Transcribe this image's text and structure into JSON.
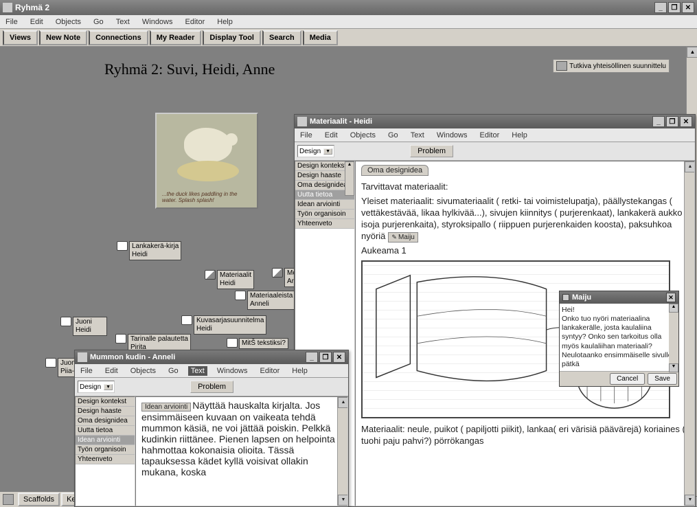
{
  "main": {
    "title": "Ryhmä 2",
    "menus": [
      "File",
      "Edit",
      "Objects",
      "Go",
      "Text",
      "Windows",
      "Editor",
      "Help"
    ],
    "toolbar": [
      "Views",
      "New Note",
      "Connections",
      "My Reader",
      "Display Tool",
      "Search",
      "Media"
    ],
    "page_heading": "Ryhmä 2: Suvi, Heidi, Anne",
    "link_label": "Tutkiva yhteisöllinen suunnittelu",
    "thumb_caption": "...the duck likes paddling in the water. Splash splash!"
  },
  "nodes": {
    "lankakera": "Lankakerä-kirja\nHeidi",
    "materiaalit": "Materiaalit\nHeidi",
    "moni": "Moni\nAnne",
    "materiaaleista": "Materiaaleista\nAnneli",
    "juoni": "Juoni\nHeidi",
    "kuvasarja": "Kuvasarjasuunnitelma\nHeidi",
    "tarinalle": "Tarinalle palautetta\nPirita",
    "mits": "MitŠ tekstiksi?",
    "juonel": "Juonel\nPiia-R"
  },
  "win_mat": {
    "title": "Materiaalit - Heidi",
    "menus": [
      "File",
      "Edit",
      "Objects",
      "Go",
      "Text",
      "Windows",
      "Editor",
      "Help"
    ],
    "combo": "Design",
    "tab": "Problem",
    "list": [
      "Design kontekst",
      "Design haaste",
      "Oma designidea",
      "Uutta tietoa",
      "Idean arviointi",
      "Työn organisoin",
      "Yhteenveto"
    ],
    "sel_idx": 3,
    "ctab": "Oma designidea",
    "p1": "Tarvittavat materiaalit:",
    "p2": "Yleiset materiaalit: sivumateriaalit ( retki- tai voimistelupatja), päällystekangas ( vettäkestävää, likaa hylkivää...), sivujen kiinnitys ( purjerenkaat), lankakerä aukko ( isoja purjerenkaita), styroksipallo ( riippuen purjerenkaiden koosta), paksuhkoa nyöriä",
    "badge": "Maiju",
    "p3": "Aukeama 1",
    "p4": "Materiaalit: neule, puikot ( papiljotti piikit), lankaa( eri värisiä päävärejä) koriaines ( tuohi paju pahvi?) pörrökangas"
  },
  "win_mum": {
    "title": "Mummon kudin - Anneli",
    "menus": [
      "File",
      "Edit",
      "Objects",
      "Go",
      "Text",
      "Windows",
      "Editor",
      "Help"
    ],
    "combo": "Design",
    "tab": "Problem",
    "list": [
      "Design kontekst",
      "Design haaste",
      "Oma designidea",
      "Uutta tietoa",
      "Idean arviointi",
      "Työn organisoin",
      "Yhteenveto"
    ],
    "sel_idx": 4,
    "lead": "Idean arviointi",
    "body": "Näyttää hauskalta kirjalta. Jos ensimmäiseen kuvaan on vaikeata tehdä mummon käsiä, ne voi jättää poiskin. Pelkkä kudinkin riittänee. Pienen lapsen on helpointa hahmottaa kokonaisia olioita. Tässä tapauksessa kädet kyllä voisivat ollakin mukana, koska"
  },
  "popup": {
    "title": "Maiju",
    "body": "Hei!\nOnko tuo nyöri materiaalina lankakerälle, josta kaulaliina syntyy? Onko sen tarkoitus olla myös kaulaliihan materiaali? Neulotaanko ensimmäiselle sivulle pätkä",
    "cancel": "Cancel",
    "save": "Save"
  },
  "bottom": {
    "scaffolds": "Scaffolds",
    "ket": "Ket"
  }
}
